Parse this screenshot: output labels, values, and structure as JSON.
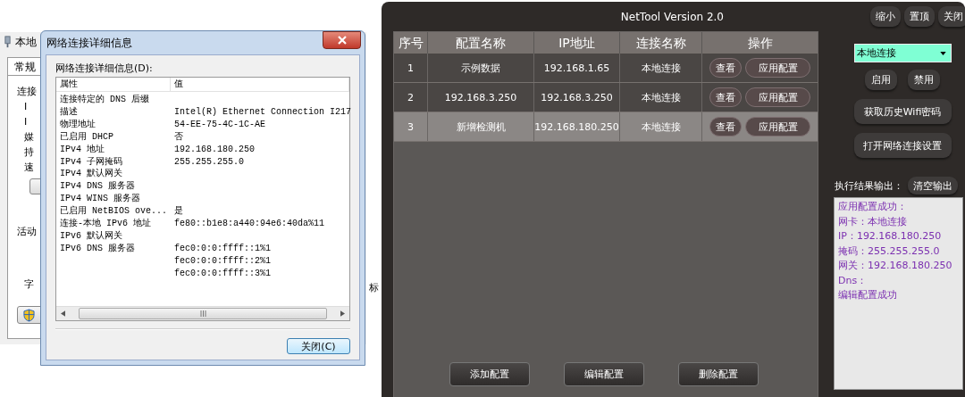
{
  "background_window": {
    "title": "本地",
    "tab": "常规",
    "section_label": "连接",
    "field_labels": [
      "I",
      "I",
      "媒",
      "持",
      "速"
    ],
    "activity_label": "活动",
    "bottom_label": "字"
  },
  "side_fragment": "标",
  "dialog": {
    "title": "网络连接详细信息",
    "group_label": "网络连接详细信息(D):",
    "columns": [
      "属性",
      "值"
    ],
    "rows": [
      {
        "property": "连接特定的 DNS 后缀"
      },
      {
        "property": "描述",
        "values": [
          "Intel(R) Ethernet Connection I217"
        ]
      },
      {
        "property": "物理地址",
        "values": [
          "54-EE-75-4C-1C-AE"
        ]
      },
      {
        "property": "已启用 DHCP",
        "values": [
          "否"
        ]
      },
      {
        "property": "IPv4 地址",
        "values": [
          "192.168.180.250"
        ]
      },
      {
        "property": "IPv4 子网掩码",
        "values": [
          "255.255.255.0"
        ]
      },
      {
        "property": "IPv4 默认网关"
      },
      {
        "property": "IPv4 DNS 服务器"
      },
      {
        "property": "IPv4 WINS 服务器"
      },
      {
        "property": "已启用 NetBIOS ove...",
        "values": [
          "是"
        ]
      },
      {
        "property": "连接-本地 IPv6 地址",
        "values": [
          "fe80::b1e8:a440:94e6:40da%11"
        ]
      },
      {
        "property": "IPv6 默认网关"
      },
      {
        "property": "IPv6 DNS 服务器",
        "values": [
          "fec0:0:0:ffff::1%1",
          "fec0:0:0:ffff::2%1",
          "fec0:0:0:ffff::3%1"
        ]
      }
    ],
    "close_button": "关闭(C)"
  },
  "app": {
    "title": "NetTool Version 2.0",
    "window_buttons": [
      "缩小",
      "置顶",
      "关闭"
    ],
    "table": {
      "columns": [
        "序号",
        "配置名称",
        "IP地址",
        "连接名称",
        "操作"
      ],
      "rows": [
        {
          "index": "1",
          "name": "示例数据",
          "ip": "192.168.1.65",
          "connection": "本地连接",
          "actions": [
            "查看",
            "应用配置"
          ],
          "selected": false
        },
        {
          "index": "2",
          "name": "192.168.3.250",
          "ip": "192.168.3.250",
          "connection": "本地连接",
          "actions": [
            "查看",
            "应用配置"
          ],
          "selected": false
        },
        {
          "index": "3",
          "name": "新增检测机",
          "ip": "192.168.180.250",
          "connection": "本地连接",
          "actions": [
            "查看",
            "应用配置"
          ],
          "selected": true
        }
      ]
    },
    "bottom_buttons": [
      "添加配置",
      "编辑配置",
      "删除配置"
    ],
    "adapter_select": {
      "value": "本地连接"
    },
    "adapter_buttons": [
      "启用",
      "禁用"
    ],
    "tool_buttons": [
      "获取历史Wifi密码",
      "打开网络连接设置"
    ],
    "output": {
      "label": "执行结果输出：",
      "clear_button": "清空输出",
      "lines": [
        "应用配置成功：",
        "网卡：本地连接",
        "IP：192.168.180.250",
        "掩码：255.255.255.0",
        "网关：192.168.180.250",
        "Dns：",
        "编辑配置成功"
      ]
    }
  }
}
